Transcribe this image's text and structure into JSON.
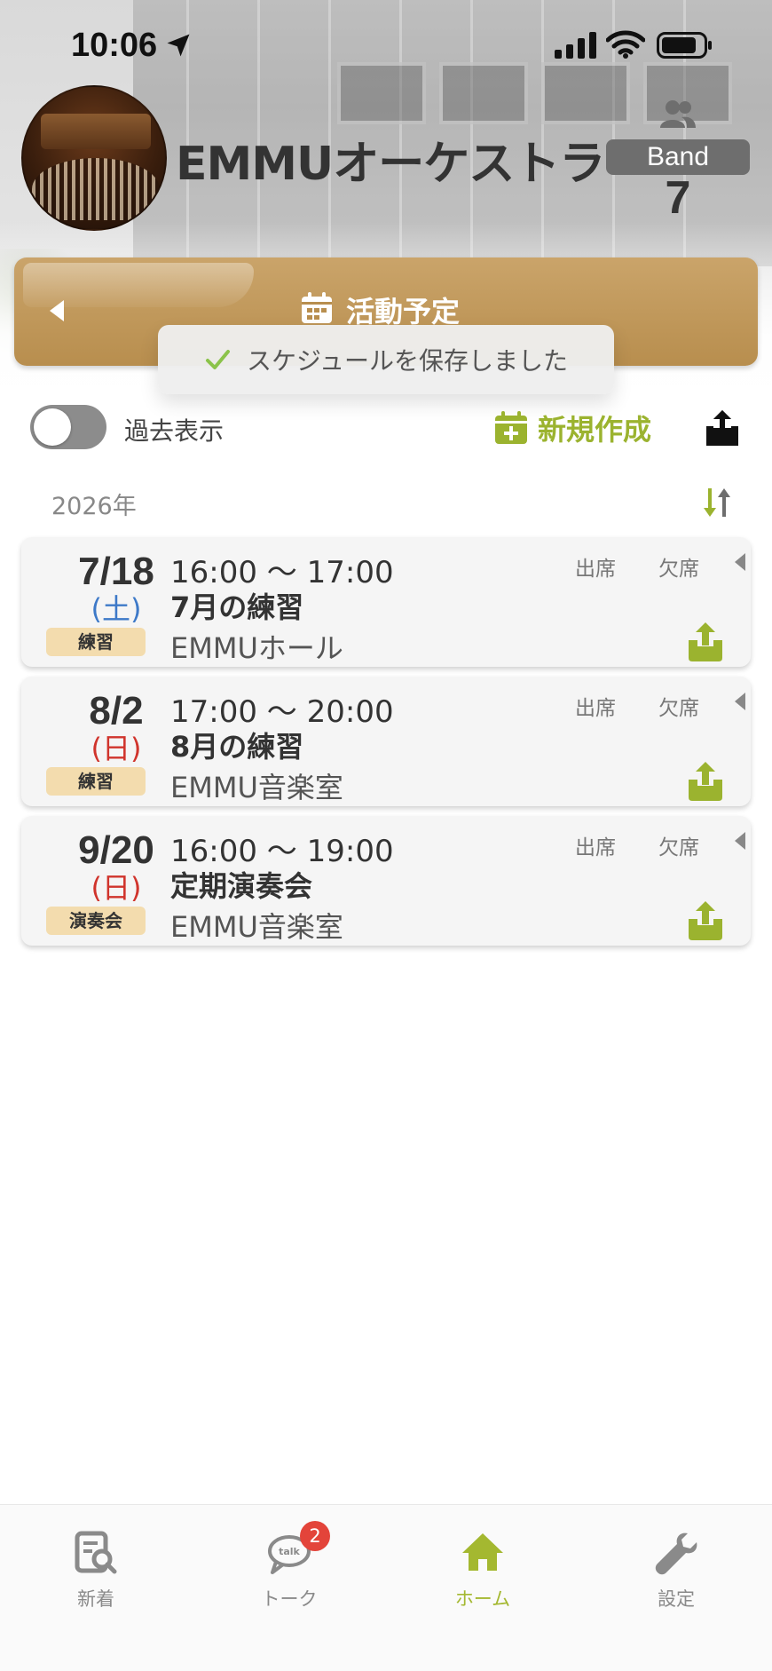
{
  "status_bar": {
    "time": "10:06"
  },
  "band": {
    "name": "EMMUオーケストラ",
    "badge": "Band",
    "member_count": "7"
  },
  "header": {
    "title": "活動予定"
  },
  "toast": {
    "message": "スケジュールを保存しました"
  },
  "toolbar": {
    "past_toggle_label": "過去表示",
    "past_toggle_on": false,
    "new_label": "新規作成"
  },
  "year_label": "2026年",
  "events": [
    {
      "date": "7/18",
      "weekday": "(土)",
      "weekday_type": "sat",
      "tag": "練習",
      "time": "16:00 〜 17:00",
      "title": "7月の練習",
      "place": "EMMUホール",
      "attend_label": "出席",
      "absent_label": "欠席"
    },
    {
      "date": "8/2",
      "weekday": "(日)",
      "weekday_type": "sun",
      "tag": "練習",
      "time": "17:00 〜 20:00",
      "title": "8月の練習",
      "place": "EMMU音楽室",
      "attend_label": "出席",
      "absent_label": "欠席"
    },
    {
      "date": "9/20",
      "weekday": "(日)",
      "weekday_type": "sun",
      "tag": "演奏会",
      "time": "16:00 〜 19:00",
      "title": "定期演奏会",
      "place": "EMMU音楽室",
      "attend_label": "出席",
      "absent_label": "欠席"
    }
  ],
  "tabs": [
    {
      "label": "新着",
      "icon": "news-search-icon",
      "active": false
    },
    {
      "label": "トーク",
      "icon": "talk-bubble-icon",
      "active": false,
      "badge": "2"
    },
    {
      "label": "ホーム",
      "icon": "home-icon",
      "active": true
    },
    {
      "label": "設定",
      "icon": "wrench-icon",
      "active": false
    }
  ],
  "colors": {
    "accent_green": "#a4b830",
    "header_gold": "#b88e4e",
    "tag_bg": "#f3dcae",
    "saturday_blue": "#3d79c8",
    "sunday_red": "#d0342c",
    "badge_red": "#e3443a"
  }
}
